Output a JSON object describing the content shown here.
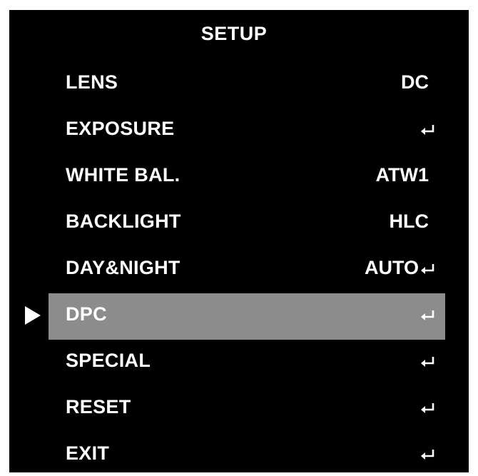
{
  "osd": {
    "title": "SETUP",
    "selected_index": 5,
    "items": [
      {
        "label": "LENS",
        "value": "DC",
        "enter": false
      },
      {
        "label": "EXPOSURE",
        "value": "",
        "enter": true
      },
      {
        "label": "WHITE BAL.",
        "value": "ATW1",
        "enter": false
      },
      {
        "label": "BACKLIGHT",
        "value": "HLC",
        "enter": false
      },
      {
        "label": "DAY&NIGHT",
        "value": "AUTO",
        "enter": true
      },
      {
        "label": "DPC",
        "value": "",
        "enter": true
      },
      {
        "label": "SPECIAL",
        "value": "",
        "enter": true
      },
      {
        "label": "RESET",
        "value": "",
        "enter": true
      },
      {
        "label": "EXIT",
        "value": "",
        "enter": true
      }
    ],
    "icons": {
      "cursor": "play-arrow-icon",
      "enter": "enter-return-icon"
    },
    "colors": {
      "background": "#000000",
      "text": "#ffffff",
      "selection": "#8c8c8c"
    }
  }
}
